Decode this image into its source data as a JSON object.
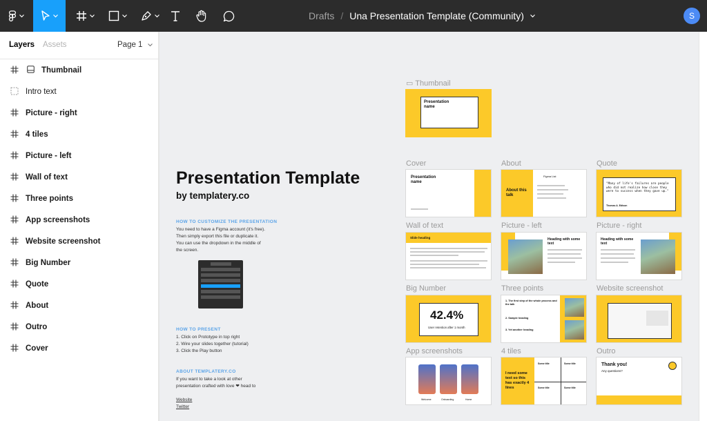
{
  "toolbar": {
    "tools": [
      {
        "name": "main-menu",
        "icon": "figma-logo-icon",
        "active": false
      },
      {
        "name": "move",
        "icon": "move-cursor-icon",
        "active": true
      },
      {
        "name": "frame",
        "icon": "frame-grid-icon",
        "active": false
      },
      {
        "name": "shape",
        "icon": "rectangle-icon",
        "active": false
      },
      {
        "name": "pen",
        "icon": "pen-icon",
        "active": false
      },
      {
        "name": "text",
        "icon": "text-icon",
        "active": false
      },
      {
        "name": "hand",
        "icon": "hand-icon",
        "active": false
      },
      {
        "name": "comment",
        "icon": "comment-icon",
        "active": false
      }
    ],
    "breadcrumb_drafts": "Drafts",
    "breadcrumb_sep": "/",
    "file_name": "Una Presentation Template (Community)",
    "avatar_initial": "S"
  },
  "panel": {
    "tab_layers": "Layers",
    "tab_assets": "Assets",
    "page_selector": "Page 1",
    "layers": [
      {
        "label": "Thumbnail",
        "icon": "frame-icon",
        "selected": false,
        "bold": true,
        "extra_icon": "thumbnail-icon"
      },
      {
        "label": "Intro text",
        "icon": "dashed-frame-icon",
        "bold": false
      },
      {
        "label": "Picture - right",
        "icon": "frame-icon",
        "bold": true
      },
      {
        "label": "4 tiles",
        "icon": "frame-icon",
        "bold": true
      },
      {
        "label": "Picture - left",
        "icon": "frame-icon",
        "bold": true
      },
      {
        "label": "Wall of text",
        "icon": "frame-icon",
        "bold": true
      },
      {
        "label": "Three points",
        "icon": "frame-icon",
        "bold": true
      },
      {
        "label": "App screenshots",
        "icon": "frame-icon",
        "bold": true
      },
      {
        "label": "Website screenshot",
        "icon": "frame-icon",
        "bold": true
      },
      {
        "label": "Big Number",
        "icon": "frame-icon",
        "bold": true
      },
      {
        "label": "Quote",
        "icon": "frame-icon",
        "bold": true
      },
      {
        "label": "About",
        "icon": "frame-icon",
        "bold": true
      },
      {
        "label": "Outro",
        "icon": "frame-icon",
        "bold": true
      },
      {
        "label": "Cover",
        "icon": "frame-icon",
        "bold": true
      }
    ]
  },
  "doc": {
    "title": "Presentation Template",
    "subtitle": "by templatery.co",
    "h_customize": "HOW TO CUSTOMIZE THE PRESENTATION",
    "p_customize": [
      "You need to have a Figma account (it's free).",
      "Then simply export this file or duplicate it.",
      "You can use the dropdown in the middle of",
      "the screen."
    ],
    "h_present": "HOW TO PRESENT",
    "p_present": [
      "1. Click on Prototype in top right",
      "2. Wire your slides together (tutorial)",
      "3. Click the Play button"
    ],
    "h_about": "ABOUT TEMPLATERY.CO",
    "p_about": [
      "If you want to take a look at other",
      "presentation crafted with love ❤ head to"
    ],
    "link_website": "Website",
    "link_twitter": "Twitter"
  },
  "frames": {
    "thumbnail": {
      "label": "Thumbnail",
      "title": "Presentation name"
    },
    "cover": {
      "label": "Cover",
      "title": "Presentation name"
    },
    "about": {
      "label": "About",
      "title": "About this talk",
      "side": "Figma List"
    },
    "quote": {
      "label": "Quote",
      "text": "\"Many of life's failures are people who did not realize how close they were to success when they gave up.\"",
      "author": "Thomas A. Edison"
    },
    "wall": {
      "label": "Wall of text",
      "heading": "Slide heading"
    },
    "picleft": {
      "label": "Picture - left",
      "heading": "Heading with some text"
    },
    "picright": {
      "label": "Picture - right",
      "heading": "Heading with some text"
    },
    "bignum": {
      "label": "Big Number",
      "value": "42.4%",
      "caption": "User retention after 1 month"
    },
    "three": {
      "label": "Three points",
      "p1": "1. The first step of the whole process and the talk",
      "p2": "2. Sample heading",
      "p3": "3. Yet another heading"
    },
    "website": {
      "label": "Website screenshot"
    },
    "apps": {
      "label": "App screenshots",
      "captions": [
        "Welcome",
        "Onboarding",
        "Home"
      ]
    },
    "tiles": {
      "label": "4 tiles",
      "main": "I need some text so this has exactly 4 lines",
      "tile_title": "Some title"
    },
    "outro": {
      "label": "Outro",
      "title": "Thank you!",
      "sub": "Any questions?"
    }
  },
  "colors": {
    "accent": "#fcc929",
    "toolbar": "#2c2c2c",
    "selection": "#18a0fb",
    "section_heading": "#5aa3e8"
  }
}
